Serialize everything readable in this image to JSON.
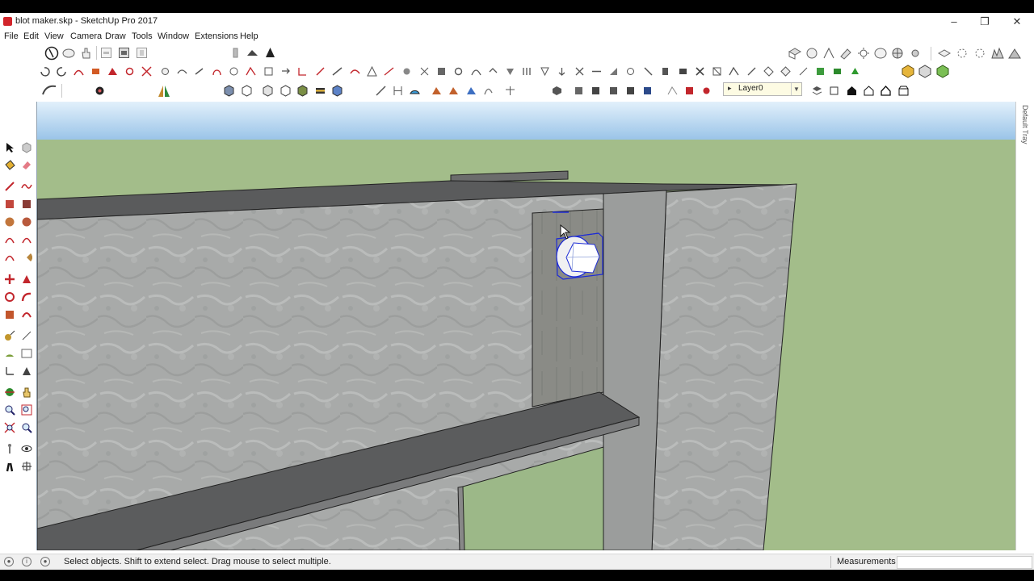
{
  "window": {
    "title": "blot maker.skp - SketchUp Pro 2017",
    "minimize": "–",
    "maximize": "❐",
    "close": "✕"
  },
  "menu": [
    "File",
    "Edit",
    "View",
    "Camera",
    "Draw",
    "Tools",
    "Window",
    "Extensions",
    "Help"
  ],
  "layer": {
    "selected": "Layer0"
  },
  "tray": {
    "label": "Default Tray"
  },
  "status": {
    "hint": "Select objects. Shift to extend select. Drag mouse to select multiple.",
    "measurements_label": "Measurements",
    "measurements_value": ""
  },
  "colors": {
    "sky_top": "#e2f0fb",
    "sky_bottom": "#9ac4e8",
    "ground": "#a3bd8a",
    "concrete": "#a8aaa9",
    "selection": "#1d2bd6",
    "toolbar_accent": "#d2252b"
  }
}
